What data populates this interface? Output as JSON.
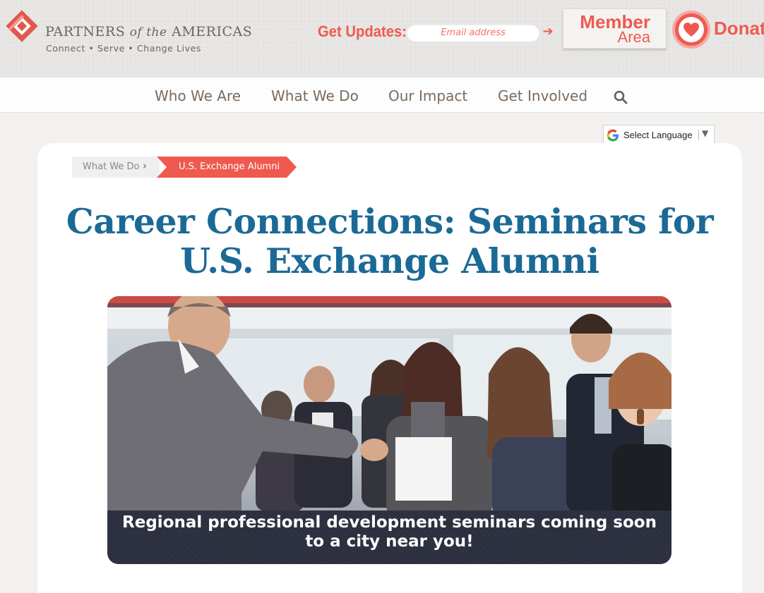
{
  "brand": {
    "name_part1": "PARTNERS",
    "name_of": "of the",
    "name_part2": "AMERICAS",
    "tagline": "Connect • Serve • Change Lives"
  },
  "header": {
    "updates_label": "Get Updates:",
    "email_placeholder": "Email address",
    "member_line1": "Member",
    "member_line2": "Area",
    "donate_label": "Donat"
  },
  "nav": {
    "items": [
      {
        "label": "Who We Are"
      },
      {
        "label": "What We Do"
      },
      {
        "label": "Our Impact"
      },
      {
        "label": "Get Involved"
      }
    ]
  },
  "language": {
    "label": "Select Language"
  },
  "breadcrumb": {
    "items": [
      {
        "label": "What We Do"
      },
      {
        "label": "U.S. Exchange Alumni"
      }
    ]
  },
  "page": {
    "title_line1": "Career Connections: Seminars for",
    "title_line2": "U.S. Exchange Alumni"
  },
  "hero": {
    "caption_line1": "Regional professional development seminars coming soon",
    "caption_line2": "to a city near you!"
  },
  "colors": {
    "accent": "#ef5a4f",
    "title_blue": "#1b6a96",
    "nav_text": "#7a6a5c"
  }
}
